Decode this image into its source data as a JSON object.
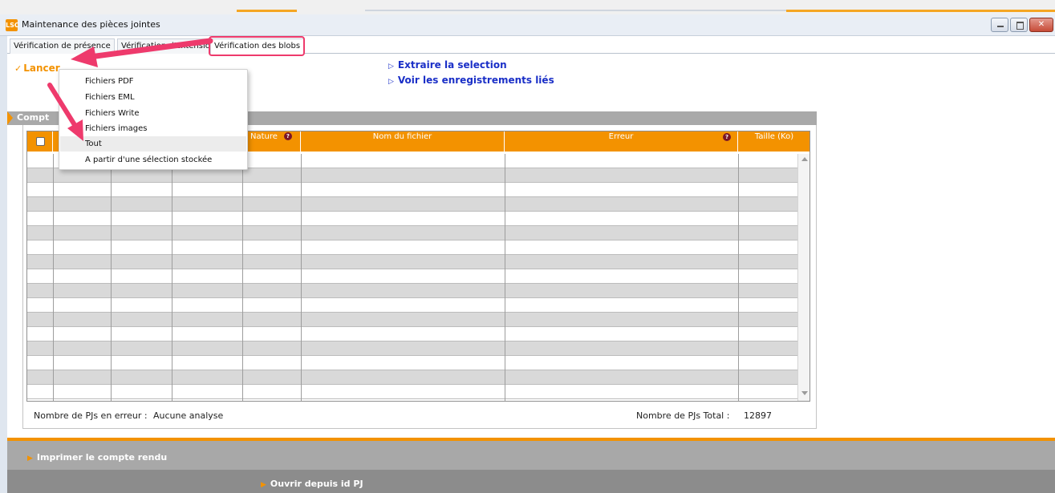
{
  "window": {
    "title": "Maintenance des pièces jointes",
    "logo_text": "LSC",
    "close_glyph": "✕"
  },
  "tabs": [
    {
      "label": "Vérification de présence"
    },
    {
      "label": "Vérification d'extension"
    },
    {
      "label": "Vérification des blobs"
    }
  ],
  "actions": {
    "lancer": "Lancer",
    "extraire": "Extraire la selection",
    "voir": "Voir les enregistrements liés"
  },
  "menu": {
    "items": [
      {
        "label": "Fichiers PDF"
      },
      {
        "label": "Fichiers EML"
      },
      {
        "label": "Fichiers Write"
      },
      {
        "label": "Fichiers images"
      },
      {
        "label": "Tout"
      },
      {
        "label": "A partir d'une sélection stockée"
      }
    ]
  },
  "section": {
    "title": "Compt"
  },
  "grid": {
    "columns": [
      {
        "label": ""
      },
      {
        "label": ""
      },
      {
        "label": ""
      },
      {
        "label": ""
      },
      {
        "label": "Nature"
      },
      {
        "label": "Nom du fichier"
      },
      {
        "label": "Erreur"
      },
      {
        "label": "Taille (Ko)"
      }
    ],
    "help_glyph": "?"
  },
  "footer": {
    "errors_label": "Nombre de PJs en erreur :",
    "errors_value": "Aucune analyse",
    "total_label": "Nombre de PJs Total :",
    "total_value": "12897"
  },
  "bottom": {
    "imprimer": "Imprimer le compte rendu",
    "ouvrir": "Ouvrir depuis id PJ"
  },
  "colors": {
    "accent": "#f39200",
    "link": "#1a2fc7",
    "annotation": "#ee3a6c"
  }
}
